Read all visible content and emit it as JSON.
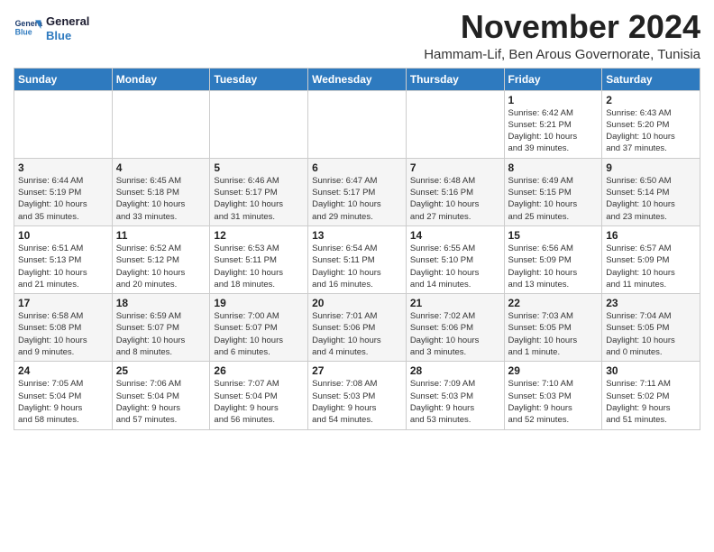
{
  "logo": {
    "line1": "General",
    "line2": "Blue"
  },
  "title": "November 2024",
  "subtitle": "Hammam-Lif, Ben Arous Governorate, Tunisia",
  "headers": [
    "Sunday",
    "Monday",
    "Tuesday",
    "Wednesday",
    "Thursday",
    "Friday",
    "Saturday"
  ],
  "weeks": [
    [
      {
        "day": "",
        "info": ""
      },
      {
        "day": "",
        "info": ""
      },
      {
        "day": "",
        "info": ""
      },
      {
        "day": "",
        "info": ""
      },
      {
        "day": "",
        "info": ""
      },
      {
        "day": "1",
        "info": "Sunrise: 6:42 AM\nSunset: 5:21 PM\nDaylight: 10 hours\nand 39 minutes."
      },
      {
        "day": "2",
        "info": "Sunrise: 6:43 AM\nSunset: 5:20 PM\nDaylight: 10 hours\nand 37 minutes."
      }
    ],
    [
      {
        "day": "3",
        "info": "Sunrise: 6:44 AM\nSunset: 5:19 PM\nDaylight: 10 hours\nand 35 minutes."
      },
      {
        "day": "4",
        "info": "Sunrise: 6:45 AM\nSunset: 5:18 PM\nDaylight: 10 hours\nand 33 minutes."
      },
      {
        "day": "5",
        "info": "Sunrise: 6:46 AM\nSunset: 5:17 PM\nDaylight: 10 hours\nand 31 minutes."
      },
      {
        "day": "6",
        "info": "Sunrise: 6:47 AM\nSunset: 5:17 PM\nDaylight: 10 hours\nand 29 minutes."
      },
      {
        "day": "7",
        "info": "Sunrise: 6:48 AM\nSunset: 5:16 PM\nDaylight: 10 hours\nand 27 minutes."
      },
      {
        "day": "8",
        "info": "Sunrise: 6:49 AM\nSunset: 5:15 PM\nDaylight: 10 hours\nand 25 minutes."
      },
      {
        "day": "9",
        "info": "Sunrise: 6:50 AM\nSunset: 5:14 PM\nDaylight: 10 hours\nand 23 minutes."
      }
    ],
    [
      {
        "day": "10",
        "info": "Sunrise: 6:51 AM\nSunset: 5:13 PM\nDaylight: 10 hours\nand 21 minutes."
      },
      {
        "day": "11",
        "info": "Sunrise: 6:52 AM\nSunset: 5:12 PM\nDaylight: 10 hours\nand 20 minutes."
      },
      {
        "day": "12",
        "info": "Sunrise: 6:53 AM\nSunset: 5:11 PM\nDaylight: 10 hours\nand 18 minutes."
      },
      {
        "day": "13",
        "info": "Sunrise: 6:54 AM\nSunset: 5:11 PM\nDaylight: 10 hours\nand 16 minutes."
      },
      {
        "day": "14",
        "info": "Sunrise: 6:55 AM\nSunset: 5:10 PM\nDaylight: 10 hours\nand 14 minutes."
      },
      {
        "day": "15",
        "info": "Sunrise: 6:56 AM\nSunset: 5:09 PM\nDaylight: 10 hours\nand 13 minutes."
      },
      {
        "day": "16",
        "info": "Sunrise: 6:57 AM\nSunset: 5:09 PM\nDaylight: 10 hours\nand 11 minutes."
      }
    ],
    [
      {
        "day": "17",
        "info": "Sunrise: 6:58 AM\nSunset: 5:08 PM\nDaylight: 10 hours\nand 9 minutes."
      },
      {
        "day": "18",
        "info": "Sunrise: 6:59 AM\nSunset: 5:07 PM\nDaylight: 10 hours\nand 8 minutes."
      },
      {
        "day": "19",
        "info": "Sunrise: 7:00 AM\nSunset: 5:07 PM\nDaylight: 10 hours\nand 6 minutes."
      },
      {
        "day": "20",
        "info": "Sunrise: 7:01 AM\nSunset: 5:06 PM\nDaylight: 10 hours\nand 4 minutes."
      },
      {
        "day": "21",
        "info": "Sunrise: 7:02 AM\nSunset: 5:06 PM\nDaylight: 10 hours\nand 3 minutes."
      },
      {
        "day": "22",
        "info": "Sunrise: 7:03 AM\nSunset: 5:05 PM\nDaylight: 10 hours\nand 1 minute."
      },
      {
        "day": "23",
        "info": "Sunrise: 7:04 AM\nSunset: 5:05 PM\nDaylight: 10 hours\nand 0 minutes."
      }
    ],
    [
      {
        "day": "24",
        "info": "Sunrise: 7:05 AM\nSunset: 5:04 PM\nDaylight: 9 hours\nand 58 minutes."
      },
      {
        "day": "25",
        "info": "Sunrise: 7:06 AM\nSunset: 5:04 PM\nDaylight: 9 hours\nand 57 minutes."
      },
      {
        "day": "26",
        "info": "Sunrise: 7:07 AM\nSunset: 5:04 PM\nDaylight: 9 hours\nand 56 minutes."
      },
      {
        "day": "27",
        "info": "Sunrise: 7:08 AM\nSunset: 5:03 PM\nDaylight: 9 hours\nand 54 minutes."
      },
      {
        "day": "28",
        "info": "Sunrise: 7:09 AM\nSunset: 5:03 PM\nDaylight: 9 hours\nand 53 minutes."
      },
      {
        "day": "29",
        "info": "Sunrise: 7:10 AM\nSunset: 5:03 PM\nDaylight: 9 hours\nand 52 minutes."
      },
      {
        "day": "30",
        "info": "Sunrise: 7:11 AM\nSunset: 5:02 PM\nDaylight: 9 hours\nand 51 minutes."
      }
    ]
  ]
}
